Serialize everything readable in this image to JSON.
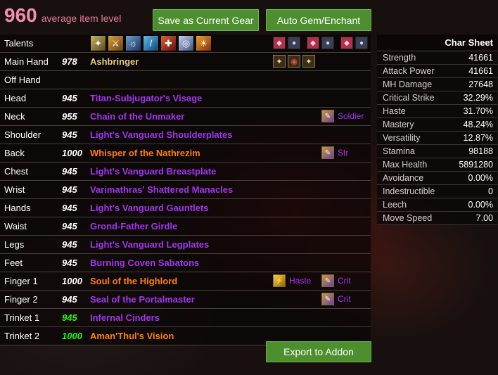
{
  "header": {
    "ilvl": "960",
    "ilvl_label": "average item level"
  },
  "buttons": {
    "save": "Save as Current Gear",
    "gem": "Auto Gem/Enchant",
    "export": "Export to Addon"
  },
  "talents_label": "Talents",
  "colors": {
    "epic": "#a335ee",
    "legendary": "#ff8000",
    "artifact": "#e6cc80",
    "accent_button": "#4d8f2f",
    "ilvl_pink": "#f28fae"
  },
  "gear": [
    {
      "slot": "Main Hand",
      "ilvl": "978",
      "name": "Ashbringer",
      "quality": "artifact"
    },
    {
      "slot": "Off Hand",
      "ilvl": "",
      "name": "",
      "quality": ""
    },
    {
      "slot": "Head",
      "ilvl": "945",
      "name": "Titan-Subjugator's Visage",
      "quality": "epic"
    },
    {
      "slot": "Neck",
      "ilvl": "955",
      "name": "Chain of the Unmaker",
      "quality": "epic",
      "enchant": "Soldier"
    },
    {
      "slot": "Shoulder",
      "ilvl": "945",
      "name": "Light's Vanguard Shoulderplates",
      "quality": "epic"
    },
    {
      "slot": "Back",
      "ilvl": "1000",
      "name": "Whisper of the Nathrezim",
      "quality": "legendary",
      "enchant": "Str"
    },
    {
      "slot": "Chest",
      "ilvl": "945",
      "name": "Light's Vanguard Breastplate",
      "quality": "epic"
    },
    {
      "slot": "Wrist",
      "ilvl": "945",
      "name": "Varimathras' Shattered Manacles",
      "quality": "epic"
    },
    {
      "slot": "Hands",
      "ilvl": "945",
      "name": "Light's Vanguard Gauntlets",
      "quality": "epic"
    },
    {
      "slot": "Waist",
      "ilvl": "945",
      "name": "Grond-Father Girdle",
      "quality": "epic"
    },
    {
      "slot": "Legs",
      "ilvl": "945",
      "name": "Light's Vanguard Legplates",
      "quality": "epic"
    },
    {
      "slot": "Feet",
      "ilvl": "945",
      "name": "Burning Coven Sabatons",
      "quality": "epic"
    },
    {
      "slot": "Finger 1",
      "ilvl": "1000",
      "name": "Soul of the Highlord",
      "quality": "legendary",
      "gem": "Haste",
      "enchant": "Crit"
    },
    {
      "slot": "Finger 2",
      "ilvl": "945",
      "name": "Seal of the Portalmaster",
      "quality": "epic",
      "enchant": "Crit"
    },
    {
      "slot": "Trinket 1",
      "ilvl": "945",
      "name": "Infernal Cinders",
      "quality": "epic",
      "ilvl_color": "green"
    },
    {
      "slot": "Trinket 2",
      "ilvl": "1000",
      "name": "Aman'Thul's Vision",
      "quality": "legendary",
      "ilvl_color": "green"
    }
  ],
  "talent_icons": [
    "talent-1-icon",
    "talent-2-icon",
    "talent-3-icon",
    "talent-4-icon",
    "talent-5-icon",
    "talent-6-icon",
    "talent-7-icon"
  ],
  "char_sheet": {
    "title": "Char Sheet",
    "stats": [
      {
        "k": "Strength",
        "v": "41661"
      },
      {
        "k": "Attack Power",
        "v": "41661"
      },
      {
        "k": "MH Damage",
        "v": "27648"
      },
      {
        "k": "Critical Strike",
        "v": "32.29%"
      },
      {
        "k": "Haste",
        "v": "31.70%"
      },
      {
        "k": "Mastery",
        "v": "48.24%"
      },
      {
        "k": "Versatility",
        "v": "12.87%"
      },
      {
        "k": "Stamina",
        "v": "98188"
      },
      {
        "k": "Max Health",
        "v": "5891280"
      },
      {
        "k": "Avoidance",
        "v": "0.00%"
      },
      {
        "k": "Indestructible",
        "v": "0"
      },
      {
        "k": "Leech",
        "v": "0.00%"
      },
      {
        "k": "Move Speed",
        "v": "7.00"
      }
    ]
  }
}
